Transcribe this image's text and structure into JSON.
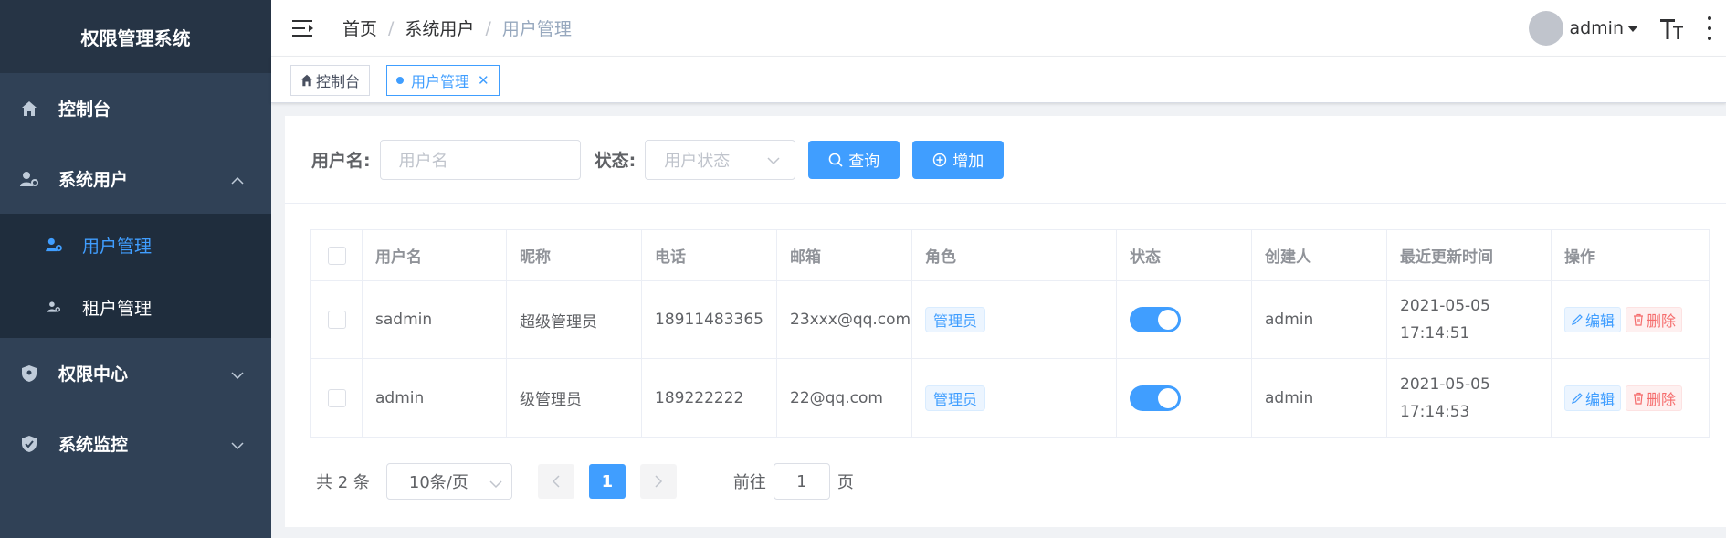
{
  "app": {
    "title": "权限管理系统"
  },
  "sidebar": {
    "items": [
      {
        "label": "控制台",
        "icon": "home-icon"
      },
      {
        "label": "系统用户",
        "icon": "user-gear-icon",
        "expanded": true,
        "children": [
          {
            "label": "用户管理",
            "icon": "user-gear-icon",
            "active": true
          },
          {
            "label": "租户管理",
            "icon": "user-gear-icon"
          }
        ]
      },
      {
        "label": "权限中心",
        "icon": "shield-icon"
      },
      {
        "label": "系统监控",
        "icon": "shield-check-icon"
      }
    ]
  },
  "header": {
    "breadcrumb": [
      "首页",
      "系统用户",
      "用户管理"
    ],
    "user": "admin"
  },
  "tags": [
    {
      "label": "控制台",
      "icon": "home-icon"
    },
    {
      "label": "用户管理",
      "active": true,
      "closable": true
    }
  ],
  "filter": {
    "username_label": "用户名:",
    "username_placeholder": "用户名",
    "status_label": "状态:",
    "status_placeholder": "用户状态",
    "search_label": "查询",
    "add_label": "增加"
  },
  "table": {
    "headers": [
      "用户名",
      "昵称",
      "电话",
      "邮箱",
      "角色",
      "状态",
      "创建人",
      "最近更新时间",
      "操作"
    ],
    "rows": [
      {
        "username": "sadmin",
        "nickname": "超级管理员",
        "phone": "18911483365",
        "email": "23xxx@qq.com",
        "role": "管理员",
        "enabled": true,
        "creator": "admin",
        "updated": "2021-05-05 17:14:51"
      },
      {
        "username": "admin",
        "nickname": "级管理员",
        "phone": "189222222",
        "email": "22@qq.com",
        "role": "管理员",
        "enabled": true,
        "creator": "admin",
        "updated": "2021-05-05 17:14:53"
      }
    ],
    "edit_label": "编辑",
    "delete_label": "删除"
  },
  "pagination": {
    "total_text": "共 2 条",
    "page_size": "10条/页",
    "current_page": "1",
    "goto_prefix": "前往",
    "goto_value": "1",
    "goto_suffix": "页"
  },
  "colors": {
    "primary": "#409eff",
    "sidebar_bg": "#304156",
    "danger": "#f56c6c"
  }
}
